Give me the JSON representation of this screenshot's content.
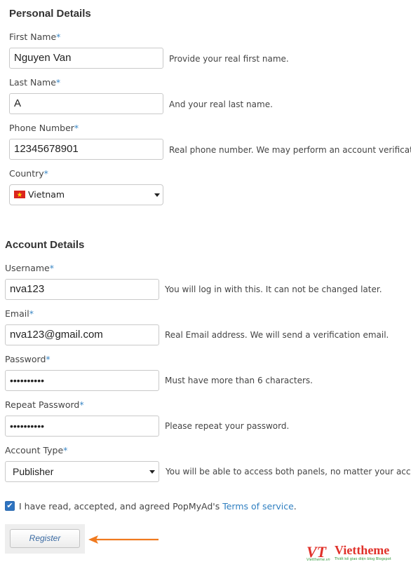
{
  "personal": {
    "title": "Personal Details",
    "first_name": {
      "label": "First Name",
      "required": "*",
      "value": "Nguyen Van",
      "hint": "Provide your real first name."
    },
    "last_name": {
      "label": "Last Name",
      "required": "*",
      "value": "A",
      "hint": "And your real last name."
    },
    "phone": {
      "label": "Phone Number",
      "required": "*",
      "value": "12345678901",
      "hint": "Real phone number. We may perform an account verification."
    },
    "country": {
      "label": "Country",
      "required": "*",
      "value": "Vietnam",
      "flag": "vietnam-flag"
    }
  },
  "account": {
    "title": "Account Details",
    "username": {
      "label": "Username",
      "required": "*",
      "value": "nva123",
      "hint": "You will log in with this. It can not be changed later."
    },
    "email": {
      "label": "Email",
      "required": "*",
      "value": "nva123@gmail.com",
      "hint": "Real Email address. We will send a verification email."
    },
    "password": {
      "label": "Password",
      "required": "*",
      "value": "••••••••••",
      "hint": "Must have more than 6 characters."
    },
    "repeat_password": {
      "label": "Repeat Password",
      "required": "*",
      "value": "••••••••••",
      "hint": "Please repeat your password."
    },
    "account_type": {
      "label": "Account Type",
      "required": "*",
      "value": "Publisher",
      "hint": "You will be able to access both panels, no matter your account"
    }
  },
  "agreement": {
    "checked": true,
    "check_glyph": "✔",
    "text": "I have read, accepted, and agreed PopMyAd's",
    "link": "Terms of service",
    "period": "."
  },
  "register": {
    "label": "Register"
  },
  "colors": {
    "accent": "#2f7fc1",
    "arrow": "#f07a1f",
    "logo_red": "#e0312a",
    "logo_green": "#2e9a3a"
  },
  "logo": {
    "mark": "VT",
    "name": "Viettheme",
    "mark_sub": "Viettheme.vn",
    "tagline": "Thiết kế giao diện blog Blogspot"
  }
}
